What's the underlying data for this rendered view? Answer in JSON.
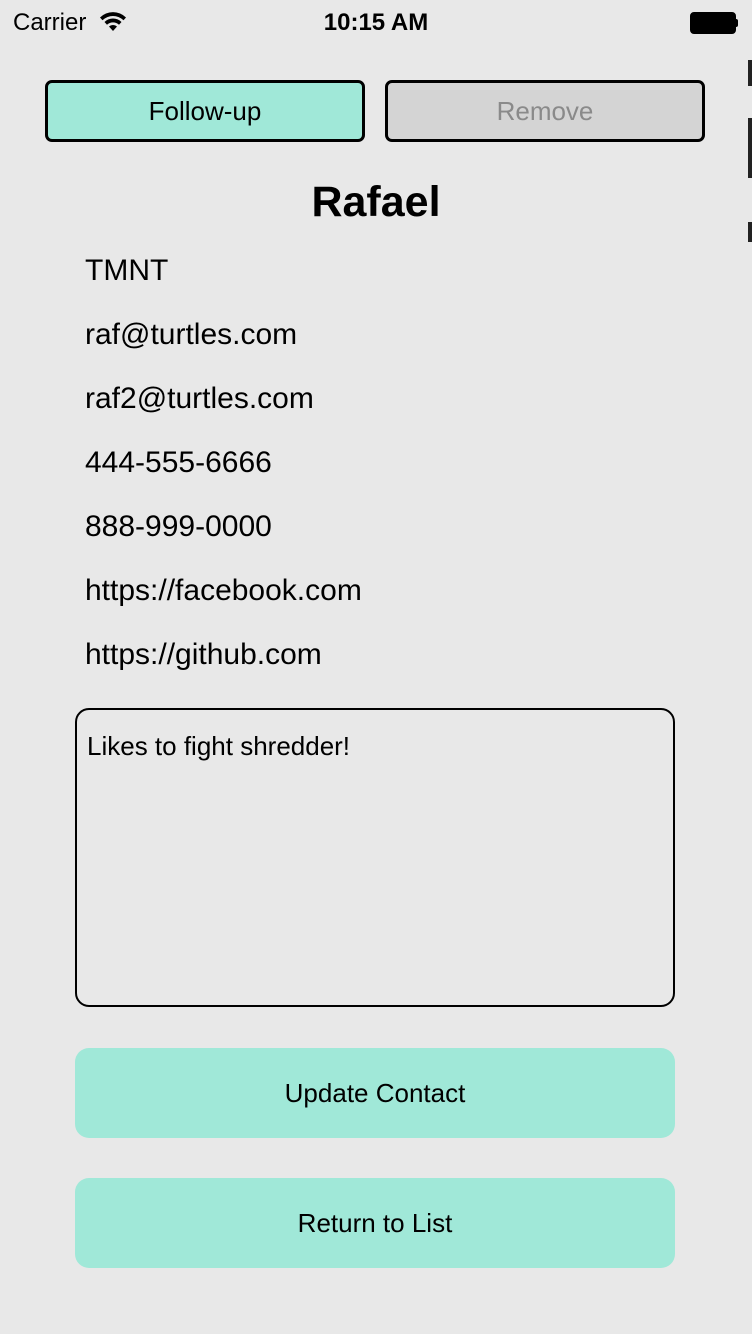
{
  "status_bar": {
    "carrier": "Carrier",
    "time": "10:15 AM",
    "wifi_icon": "wifi-icon",
    "battery_icon": "battery-icon"
  },
  "actions": {
    "follow_up_label": "Follow-up",
    "remove_label": "Remove",
    "follow_up_color": "#a0e8d8",
    "remove_color": "#d4d4d4"
  },
  "contact": {
    "name": "Rafael",
    "company": "TMNT",
    "email_1": "raf@turtles.com",
    "email_2": "raf2@turtles.com",
    "phone_1": "444-555-6666",
    "phone_2": "888-999-0000",
    "url_1": "https://facebook.com",
    "url_2": "https://github.com",
    "notes": "Likes to fight shredder!"
  },
  "buttons": {
    "update_label": "Update Contact",
    "return_label": "Return to List",
    "accent_color": "#a0e8d8"
  }
}
